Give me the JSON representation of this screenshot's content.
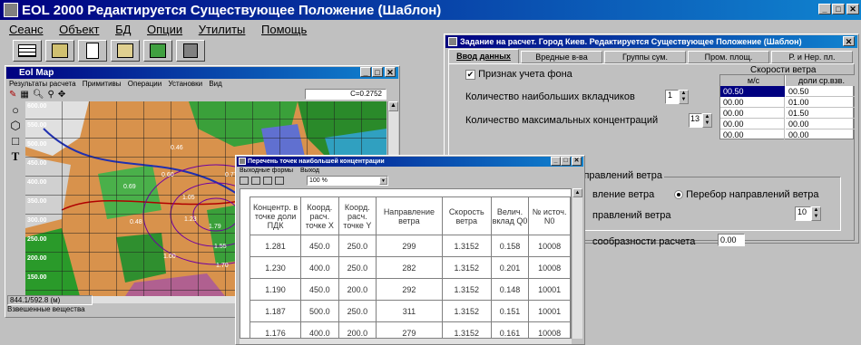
{
  "main_window": {
    "title": "EOL 2000  Редактируется Существующее Положение (Шаблон)",
    "menu": [
      "Сеанс",
      "Объект",
      "БД",
      "Опции",
      "Утилиты",
      "Помощь"
    ]
  },
  "map_window": {
    "title": "Eol Map",
    "menu": [
      "Результаты расчета",
      "Примитивы",
      "Операции",
      "Установки",
      "Вид"
    ],
    "coord": "C=0.2752",
    "ticks": [
      "600.00",
      "550.00",
      "500.00",
      "450.00",
      "400.00",
      "350.00",
      "300.00",
      "250.00",
      "200.00",
      "150.00"
    ],
    "labels": [
      "0.46",
      "0.60",
      "0.77",
      "0.69",
      "1.05",
      "0.48",
      "1.23",
      "1.79",
      "1.00",
      "1.55",
      "1.70"
    ],
    "cursor_pos": "844.1/592.8 (м)",
    "status": "Взвешенные вещества"
  },
  "task_window": {
    "title": "Задание на расчет. Город Киев. Редактируется Существующее Положение (Шаблон)",
    "tabs": [
      "Ввод данных",
      "Вредные в-ва",
      "Группы сум.",
      "Пром. площ.",
      "Р. и Нер. пл."
    ],
    "background_label": "Признак учета фона",
    "max_contrib_label": "Количество наибольших вкладчиков",
    "max_contrib_value": "1",
    "max_conc_label": "Количество максимальных концентраций",
    "max_conc_value": "13",
    "wind_speed_header": "Скорости ветра",
    "wind_cols": [
      "м/с",
      "доли ср.взв."
    ],
    "wind_rows": [
      [
        "00.50",
        "00.50"
      ],
      [
        "00.00",
        "01.00"
      ],
      [
        "00.00",
        "01.50"
      ],
      [
        "00.00",
        "00.00"
      ],
      [
        "00.00",
        "00.00"
      ]
    ],
    "direction_group_label": "Способ учета в расчете направлений ветра",
    "direction_opt1_partial": "вление ветра",
    "direction_opt2": "Перебор направлений ветра",
    "direction_count_label_partial": "правлений ветра",
    "direction_count_value": "10",
    "expediency_label_partial": "сообразности расчета",
    "expediency_value": "0.00"
  },
  "points_window": {
    "title": "Перечень точек наибольшей концентрации",
    "menu": [
      "Выходные формы",
      "Выход"
    ],
    "zoom": "100 %",
    "columns": [
      "Концентр. в точке доли ПДК",
      "Коорд. расч. точке X",
      "Коорд. расч. точке Y",
      "Направление ветра",
      "Скорость ветра",
      "Велич. вклад Q0",
      "№ источ. N0"
    ],
    "rows": [
      [
        "1.281",
        "450.0",
        "250.0",
        "299",
        "1.3152",
        "0.158",
        "10008"
      ],
      [
        "1.230",
        "400.0",
        "250.0",
        "282",
        "1.3152",
        "0.201",
        "10008"
      ],
      [
        "1.190",
        "450.0",
        "200.0",
        "292",
        "1.3152",
        "0.148",
        "10001"
      ],
      [
        "1.187",
        "500.0",
        "250.0",
        "311",
        "1.3152",
        "0.151",
        "10001"
      ],
      [
        "1.176",
        "400.0",
        "200.0",
        "279",
        "1.3152",
        "0.161",
        "10008"
      ]
    ]
  }
}
